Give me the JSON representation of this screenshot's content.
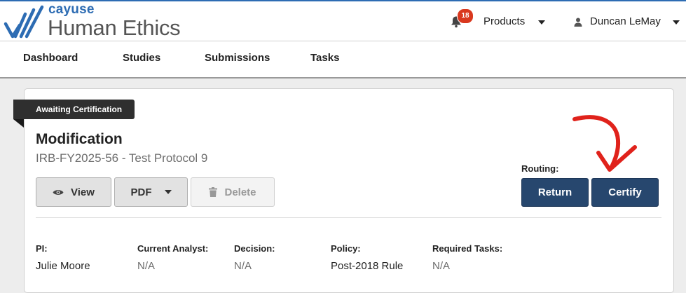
{
  "header": {
    "brand_small": "cayuse",
    "brand_large": "Human Ethics",
    "notification_count": "18",
    "products_label": "Products",
    "user_name": "Duncan LeMay"
  },
  "nav": {
    "items": [
      "Dashboard",
      "Studies",
      "Submissions",
      "Tasks"
    ]
  },
  "record": {
    "status": "Awaiting Certification",
    "title": "Modification",
    "subtitle": "IRB-FY2025-56 - Test Protocol 9"
  },
  "actions": {
    "view": "View",
    "pdf": "PDF",
    "delete": "Delete"
  },
  "routing": {
    "label": "Routing:",
    "return": "Return",
    "certify": "Certify"
  },
  "fields": [
    {
      "label": "PI:",
      "value": "Julie Moore"
    },
    {
      "label": "Current Analyst:",
      "value": "N/A"
    },
    {
      "label": "Decision:",
      "value": "N/A"
    },
    {
      "label": "Policy:",
      "value": "Post-2018 Rule"
    },
    {
      "label": "Required Tasks:",
      "value": "N/A"
    }
  ],
  "colors": {
    "brand_blue": "#2d6cb3",
    "primary_button": "#27476e",
    "badge_red": "#d9381e",
    "annotation_red": "#e0221b"
  },
  "icons": [
    "logo-icon",
    "bell-icon",
    "user-icon",
    "eye-icon",
    "trash-icon",
    "caret-down-icon",
    "red-arrow-annotation"
  ]
}
